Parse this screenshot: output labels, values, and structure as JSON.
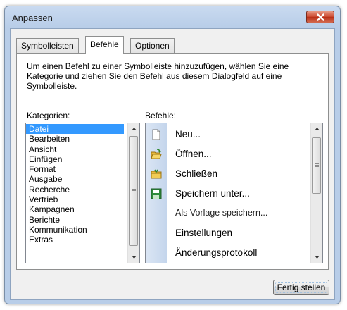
{
  "window": {
    "title": "Anpassen"
  },
  "tabs": [
    {
      "label": "Symbolleisten",
      "active": false
    },
    {
      "label": "Befehle",
      "active": true
    },
    {
      "label": "Optionen",
      "active": false
    }
  ],
  "description": "Um einen Befehl zu einer Symbolleiste hinzuzufügen, wählen Sie eine Kategorie und ziehen Sie den Befehl aus diesem Dialogfeld auf eine Symbolleiste.",
  "categories": {
    "label": "Kategorien:",
    "selected": "Datei",
    "items": [
      "Datei",
      "Bearbeiten",
      "Ansicht",
      "Einfügen",
      "Format",
      "Ausgabe",
      "Recherche",
      "Vertrieb",
      "Kampagnen",
      "Berichte",
      "Kommunikation",
      "Extras"
    ]
  },
  "commands": {
    "label": "Befehle:",
    "items": [
      {
        "label": "Neu...",
        "icon": "new-document-icon",
        "submenu": false
      },
      {
        "label": "Öffnen...",
        "icon": "open-folder-icon",
        "submenu": false
      },
      {
        "label": "Schließen",
        "icon": "close-folder-icon",
        "submenu": false
      },
      {
        "label": "Speichern unter...",
        "icon": "save-icon",
        "submenu": false
      },
      {
        "label": "Als Vorlage speichern...",
        "icon": "",
        "submenu": false
      },
      {
        "label": "Einstellungen",
        "icon": "",
        "submenu": true
      },
      {
        "label": "Änderungsprotokoll",
        "icon": "",
        "submenu": true
      }
    ]
  },
  "buttons": {
    "finish": "Fertig stellen"
  },
  "colors": {
    "selection": "#3399ff",
    "frame": "#b8cde8",
    "close_button": "#c8432a"
  }
}
